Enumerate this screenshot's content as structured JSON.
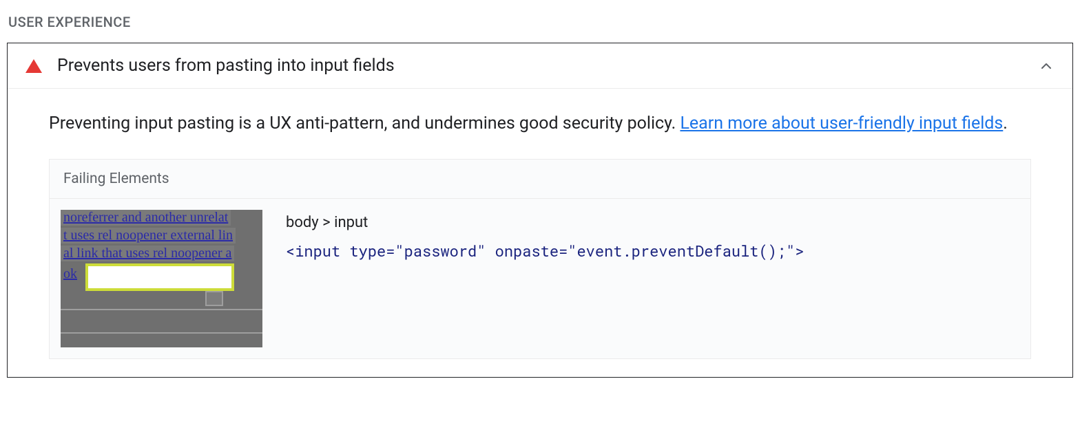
{
  "section": {
    "title": "USER EXPERIENCE"
  },
  "audit": {
    "title": "Prevents users from pasting into input fields",
    "description_prefix": "Preventing input pasting is a UX anti-pattern, and undermines good security policy. ",
    "learn_more_text": "Learn more about user-friendly input fields",
    "description_suffix": "."
  },
  "failing": {
    "header": "Failing Elements",
    "items": [
      {
        "selector": "body > input",
        "snippet": "<input type=\"password\" onpaste=\"event.preventDefault();\">",
        "thumb": {
          "line1": "noreferrer and another unrelat",
          "line2": "t uses rel noopener external lin",
          "line3": "al link that uses rel noopener a",
          "ok": "ok"
        }
      }
    ]
  }
}
